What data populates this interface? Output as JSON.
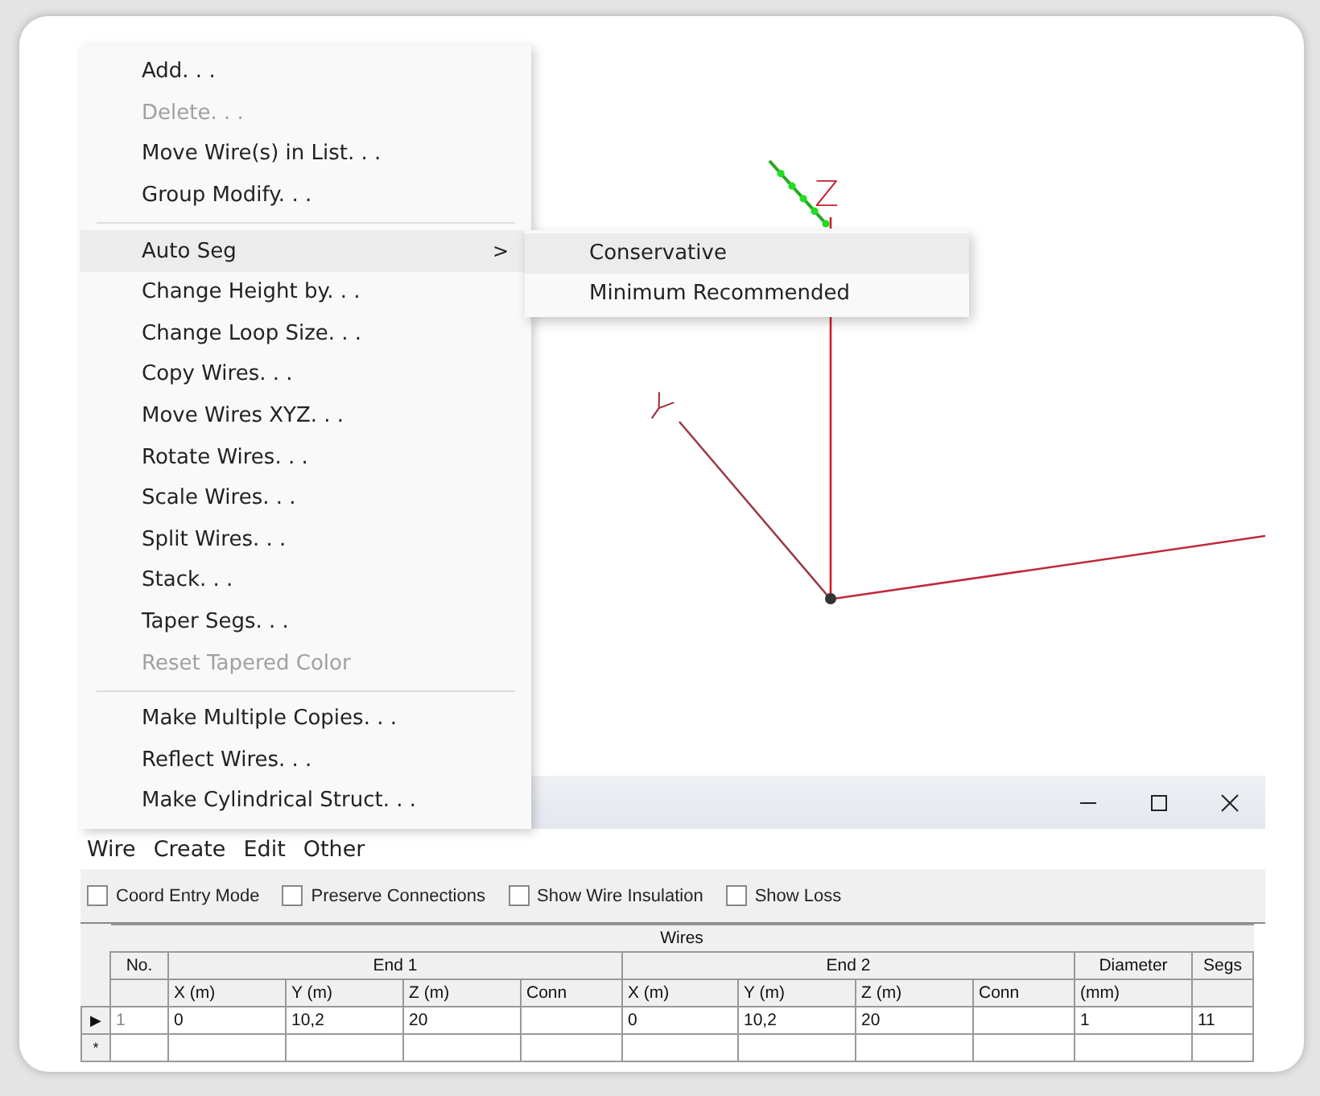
{
  "view": {
    "axis_labels": [
      "Z",
      "Y"
    ]
  },
  "context_menu": {
    "groups": [
      [
        {
          "label": "Add. . .",
          "disabled": false,
          "selected": false
        },
        {
          "label": "Delete. . .",
          "disabled": true,
          "selected": false
        },
        {
          "label": "Move Wire(s) in List. . .",
          "disabled": false,
          "selected": false
        },
        {
          "label": "Group Modify. . .",
          "disabled": false,
          "selected": false
        }
      ],
      [
        {
          "label": "Auto Seg",
          "disabled": false,
          "selected": true,
          "arrow": ">"
        },
        {
          "label": "Change Height by. . .",
          "disabled": false,
          "selected": false
        },
        {
          "label": "Change Loop Size. . .",
          "disabled": false,
          "selected": false
        },
        {
          "label": "Copy Wires. . .",
          "disabled": false,
          "selected": false
        },
        {
          "label": "Move Wires XYZ. . .",
          "disabled": false,
          "selected": false
        },
        {
          "label": "Rotate Wires. . .",
          "disabled": false,
          "selected": false
        },
        {
          "label": "Scale Wires. . .",
          "disabled": false,
          "selected": false
        },
        {
          "label": "Split Wires. . .",
          "disabled": false,
          "selected": false
        },
        {
          "label": "Stack. . .",
          "disabled": false,
          "selected": false
        },
        {
          "label": "Taper Segs. . .",
          "disabled": false,
          "selected": false
        },
        {
          "label": "Reset Tapered Color",
          "disabled": true,
          "selected": false
        }
      ],
      [
        {
          "label": "Make Multiple Copies. . .",
          "disabled": false,
          "selected": false
        },
        {
          "label": "Reflect Wires. . .",
          "disabled": false,
          "selected": false
        },
        {
          "label": "Make Cylindrical Struct. . .",
          "disabled": false,
          "selected": false
        }
      ]
    ]
  },
  "submenu": [
    {
      "label": "Conservative",
      "selected": true
    },
    {
      "label": "Minimum Recommended",
      "selected": false
    }
  ],
  "menu_bar": [
    "Wire",
    "Create",
    "Edit",
    "Other"
  ],
  "options": [
    {
      "label": "Coord Entry Mode",
      "checked": false
    },
    {
      "label": "Preserve Connections",
      "checked": false
    },
    {
      "label": "Show Wire Insulation",
      "checked": false
    },
    {
      "label": "Show Loss",
      "checked": false
    }
  ],
  "table": {
    "title": "Wires",
    "group_headers": [
      "No.",
      "End 1",
      "End 2",
      "Diameter",
      "Segs"
    ],
    "columns": [
      "",
      "X (m)",
      "Y (m)",
      "Z (m)",
      "Conn",
      "X (m)",
      "Y (m)",
      "Z (m)",
      "Conn",
      "(mm)",
      ""
    ],
    "rows": [
      {
        "marker": "▶",
        "cells": [
          "1",
          "0",
          "10,2",
          "20",
          "",
          "0",
          "10,2",
          "20",
          "",
          "1",
          "11"
        ]
      },
      {
        "marker": "*",
        "cells": [
          "",
          "",
          "",
          "",
          "",
          "",
          "",
          "",
          "",
          "",
          ""
        ]
      }
    ]
  }
}
